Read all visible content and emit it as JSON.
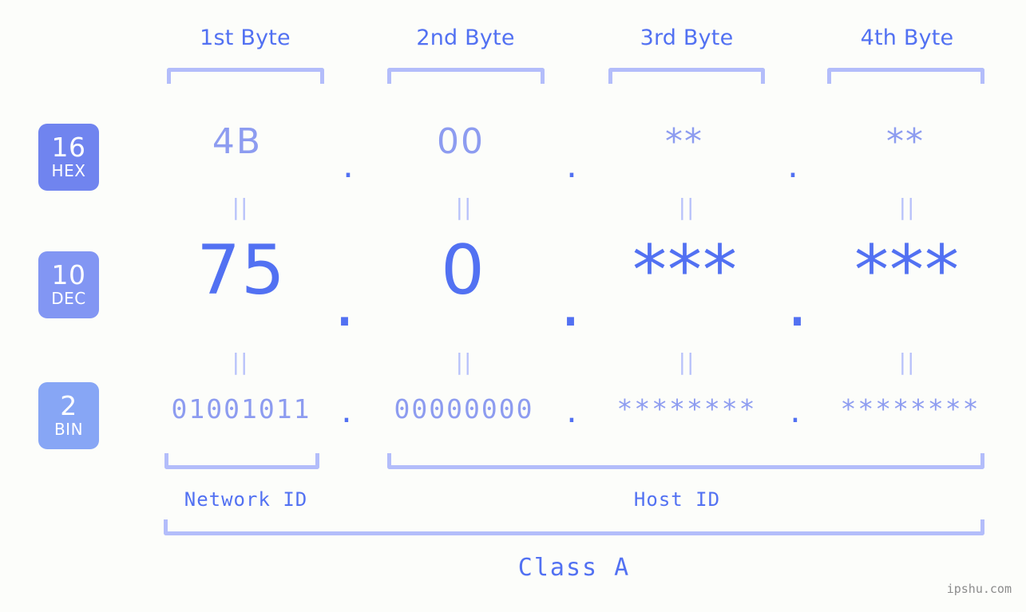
{
  "background_color": "#fcfdfa",
  "accent_color": "#5271f2",
  "muted_accent_color": "#8d9cf0",
  "bracket_color": "#b3bdfa",
  "headers": {
    "bytes": [
      {
        "label": "1st Byte"
      },
      {
        "label": "2nd Byte"
      },
      {
        "label": "3rd Byte"
      },
      {
        "label": "4th Byte"
      }
    ]
  },
  "radix_badges": [
    {
      "number": "16",
      "name": "HEX",
      "color": "#7084ef"
    },
    {
      "number": "10",
      "name": "DEC",
      "color": "#8296f3"
    },
    {
      "number": "2",
      "name": "BIN",
      "color": "#87a6f5"
    }
  ],
  "rows": {
    "hex": {
      "radix_number": "16",
      "radix_name": "HEX",
      "values": [
        "4B",
        "00",
        "**",
        "**"
      ],
      "separator": "."
    },
    "dec": {
      "radix_number": "10",
      "radix_name": "DEC",
      "values": [
        "75",
        "0",
        "***",
        "***"
      ],
      "separator": "."
    },
    "bin": {
      "radix_number": "2",
      "radix_name": "BIN",
      "values": [
        "01001011",
        "00000000",
        "********",
        "********"
      ],
      "separator": "."
    }
  },
  "connectors": {
    "symbol": "||",
    "meaning": "equals"
  },
  "regions": {
    "network_id": "Network ID",
    "host_id": "Host ID",
    "class": "Class A"
  },
  "watermark": "ipshu.com"
}
